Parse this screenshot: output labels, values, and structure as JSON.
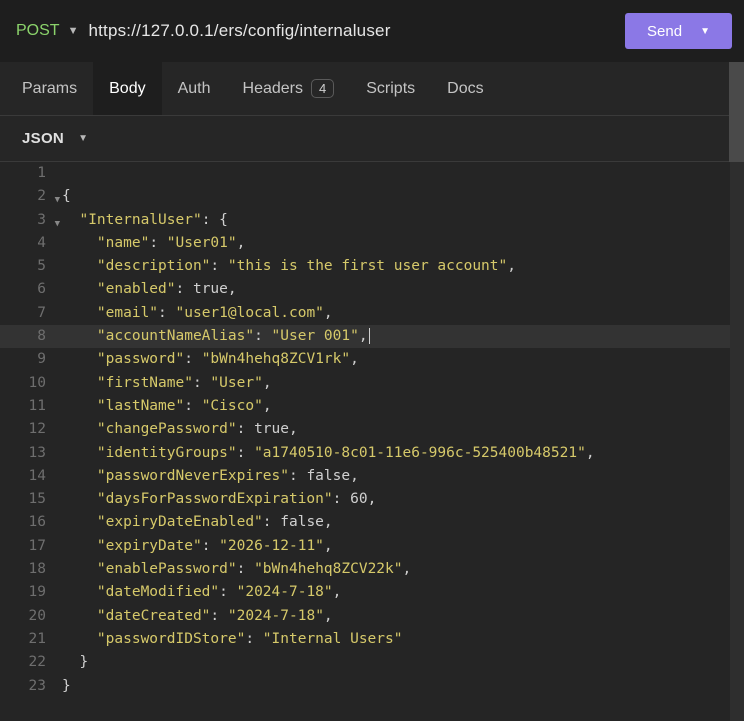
{
  "topbar": {
    "method": "POST",
    "url": "https://127.0.0.1/ers/config/internaluser",
    "send_label": "Send"
  },
  "tabs": {
    "params": "Params",
    "body": "Body",
    "auth": "Auth",
    "headers": "Headers",
    "headers_count": "4",
    "scripts": "Scripts",
    "docs": "Docs"
  },
  "formatbar": {
    "mode": "JSON"
  },
  "editor": {
    "raw_body": {
      "InternalUser": {
        "name": "User01",
        "description": "this is the first user account",
        "enabled": true,
        "email": "user1@local.com",
        "accountNameAlias": "User 001",
        "password": "bWn4hehq8ZCV1rk",
        "firstName": "User",
        "lastName": "Cisco",
        "changePassword": true,
        "identityGroups": "a1740510-8c01-11e6-996c-525400b48521",
        "passwordNeverExpires": false,
        "daysForPasswordExpiration": 60,
        "expiryDateEnabled": false,
        "expiryDate": "2026-12-11",
        "enablePassword": "bWn4hehq8ZCV22k",
        "dateModified": "2024-7-18",
        "dateCreated": "2024-7-18",
        "passwordIDStore": "Internal Users"
      }
    },
    "highlighted_line": 8,
    "lines": [
      {
        "n": 1,
        "tokens": []
      },
      {
        "n": 2,
        "fold": true,
        "tokens": [
          [
            "p",
            "{"
          ]
        ]
      },
      {
        "n": 3,
        "fold": true,
        "tokens": [
          [
            "p",
            "  "
          ],
          [
            "k",
            "\"InternalUser\""
          ],
          [
            "p",
            ": {"
          ]
        ]
      },
      {
        "n": 4,
        "tokens": [
          [
            "p",
            "    "
          ],
          [
            "k",
            "\"name\""
          ],
          [
            "p",
            ": "
          ],
          [
            "s",
            "\"User01\""
          ],
          [
            "p",
            ","
          ]
        ]
      },
      {
        "n": 5,
        "tokens": [
          [
            "p",
            "    "
          ],
          [
            "k",
            "\"description\""
          ],
          [
            "p",
            ": "
          ],
          [
            "s",
            "\"this is the first user account\""
          ],
          [
            "p",
            ","
          ]
        ]
      },
      {
        "n": 6,
        "tokens": [
          [
            "p",
            "    "
          ],
          [
            "k",
            "\"enabled\""
          ],
          [
            "p",
            ": "
          ],
          [
            "b",
            "true"
          ],
          [
            "p",
            ","
          ]
        ]
      },
      {
        "n": 7,
        "tokens": [
          [
            "p",
            "    "
          ],
          [
            "k",
            "\"email\""
          ],
          [
            "p",
            ": "
          ],
          [
            "s",
            "\"user1@local.com\""
          ],
          [
            "p",
            ","
          ]
        ]
      },
      {
        "n": 8,
        "tokens": [
          [
            "p",
            "    "
          ],
          [
            "k",
            "\"accountNameAlias\""
          ],
          [
            "p",
            ": "
          ],
          [
            "s",
            "\"User 001\""
          ],
          [
            "p",
            ","
          ],
          [
            "cursor",
            ""
          ]
        ]
      },
      {
        "n": 9,
        "tokens": [
          [
            "p",
            "    "
          ],
          [
            "k",
            "\"password\""
          ],
          [
            "p",
            ": "
          ],
          [
            "s",
            "\"bWn4hehq8ZCV1rk\""
          ],
          [
            "p",
            ","
          ]
        ]
      },
      {
        "n": 10,
        "tokens": [
          [
            "p",
            "    "
          ],
          [
            "k",
            "\"firstName\""
          ],
          [
            "p",
            ": "
          ],
          [
            "s",
            "\"User\""
          ],
          [
            "p",
            ","
          ]
        ]
      },
      {
        "n": 11,
        "tokens": [
          [
            "p",
            "    "
          ],
          [
            "k",
            "\"lastName\""
          ],
          [
            "p",
            ": "
          ],
          [
            "s",
            "\"Cisco\""
          ],
          [
            "p",
            ","
          ]
        ]
      },
      {
        "n": 12,
        "tokens": [
          [
            "p",
            "    "
          ],
          [
            "k",
            "\"changePassword\""
          ],
          [
            "p",
            ": "
          ],
          [
            "b",
            "true"
          ],
          [
            "p",
            ","
          ]
        ]
      },
      {
        "n": 13,
        "tokens": [
          [
            "p",
            "    "
          ],
          [
            "k",
            "\"identityGroups\""
          ],
          [
            "p",
            ": "
          ],
          [
            "s",
            "\"a1740510-8c01-11e6-996c-525400b48521\""
          ],
          [
            "p",
            ","
          ]
        ]
      },
      {
        "n": 14,
        "tokens": [
          [
            "p",
            "    "
          ],
          [
            "k",
            "\"passwordNeverExpires\""
          ],
          [
            "p",
            ": "
          ],
          [
            "b",
            "false"
          ],
          [
            "p",
            ","
          ]
        ]
      },
      {
        "n": 15,
        "tokens": [
          [
            "p",
            "    "
          ],
          [
            "k",
            "\"daysForPasswordExpiration\""
          ],
          [
            "p",
            ": "
          ],
          [
            "num",
            "60"
          ],
          [
            "p",
            ","
          ]
        ]
      },
      {
        "n": 16,
        "tokens": [
          [
            "p",
            "    "
          ],
          [
            "k",
            "\"expiryDateEnabled\""
          ],
          [
            "p",
            ": "
          ],
          [
            "b",
            "false"
          ],
          [
            "p",
            ","
          ]
        ]
      },
      {
        "n": 17,
        "tokens": [
          [
            "p",
            "    "
          ],
          [
            "k",
            "\"expiryDate\""
          ],
          [
            "p",
            ": "
          ],
          [
            "s",
            "\"2026-12-11\""
          ],
          [
            "p",
            ","
          ]
        ]
      },
      {
        "n": 18,
        "tokens": [
          [
            "p",
            "    "
          ],
          [
            "k",
            "\"enablePassword\""
          ],
          [
            "p",
            ": "
          ],
          [
            "s",
            "\"bWn4hehq8ZCV22k\""
          ],
          [
            "p",
            ","
          ]
        ]
      },
      {
        "n": 19,
        "tokens": [
          [
            "p",
            "    "
          ],
          [
            "k",
            "\"dateModified\""
          ],
          [
            "p",
            ": "
          ],
          [
            "s",
            "\"2024-7-18\""
          ],
          [
            "p",
            ","
          ]
        ]
      },
      {
        "n": 20,
        "tokens": [
          [
            "p",
            "    "
          ],
          [
            "k",
            "\"dateCreated\""
          ],
          [
            "p",
            ": "
          ],
          [
            "s",
            "\"2024-7-18\""
          ],
          [
            "p",
            ","
          ]
        ]
      },
      {
        "n": 21,
        "tokens": [
          [
            "p",
            "    "
          ],
          [
            "k",
            "\"passwordIDStore\""
          ],
          [
            "p",
            ": "
          ],
          [
            "s",
            "\"Internal Users\""
          ]
        ]
      },
      {
        "n": 22,
        "tokens": [
          [
            "p",
            "  }"
          ]
        ]
      },
      {
        "n": 23,
        "tokens": [
          [
            "p",
            "}"
          ]
        ]
      }
    ]
  }
}
